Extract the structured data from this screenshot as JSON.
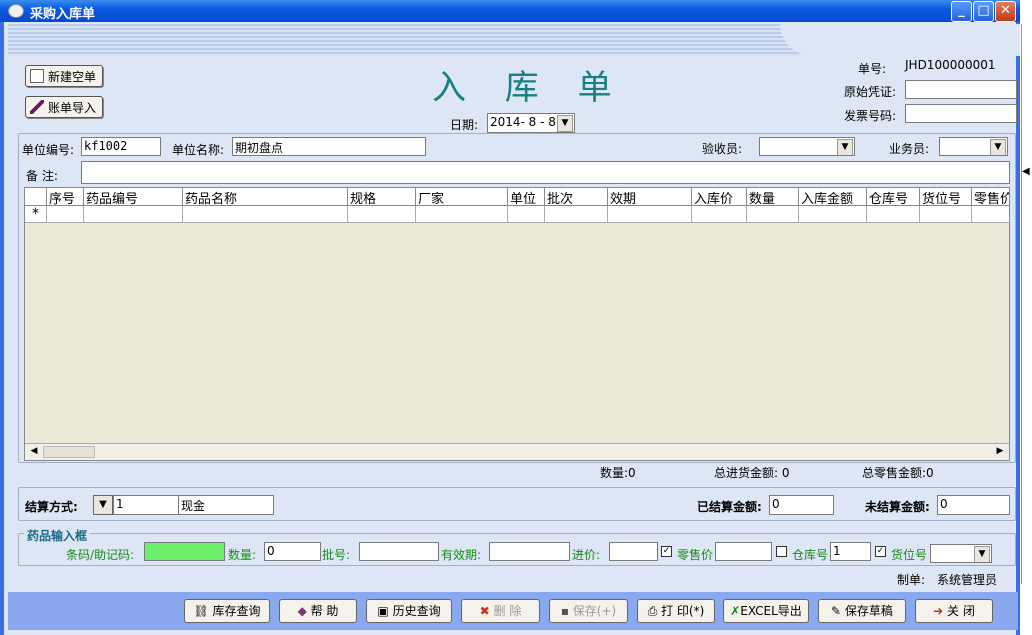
{
  "window": {
    "title": "采购入库单",
    "min": "_",
    "max": "□",
    "close": "✕"
  },
  "header": {
    "new_button": "新建空单",
    "import_button": "账单导入",
    "title": "入 库 单",
    "date_label": "日期:",
    "date_value": "2014- 8 - 8",
    "order_no_label": "单号:",
    "order_no_value": "JHD100000001",
    "voucher_label": "原始凭证:",
    "invoice_label": "发票号码:"
  },
  "form": {
    "unit_code_label": "单位编号:",
    "unit_code_value": "kf1002",
    "unit_name_label": "单位名称:",
    "unit_name_value": "期初盘点",
    "inspector_label": "验收员:",
    "salesman_label": "业务员:",
    "remark_label": "备    注:"
  },
  "grid": {
    "columns": [
      "序号",
      "药品编号",
      "药品名称",
      "规格",
      "厂家",
      "单位",
      "批次",
      "效期",
      "入库价",
      "数量",
      "入库金额",
      "仓库号",
      "货位号",
      "零售价"
    ],
    "new_row_marker": "*"
  },
  "summary": {
    "qty": "数量:0",
    "total_purchase": "总进货金额: 0",
    "total_retail": "总零售金额:0"
  },
  "settlement": {
    "method_label": "结算方式:",
    "method_code": "1",
    "method_name": "现金",
    "settled_label": "已结算金额:",
    "settled_value": "0",
    "unsettled_label": "未结算金额:",
    "unsettled_value": "0"
  },
  "input_box": {
    "group_title": "药品输入框",
    "barcode_label": "条码/助记码:",
    "qty_label": "数量:",
    "qty_value": "0",
    "batch_label": "批号:",
    "expiry_label": "有效期:",
    "price_label": "进价:",
    "retail_label": "零售价",
    "warehouse_label": "仓库号",
    "warehouse_value": "1",
    "location_label": "货位号"
  },
  "footer": {
    "maker_label": "制单:",
    "maker_value": "系统管理员"
  },
  "toolbar": {
    "stock_query": "库存查询",
    "help": "帮 助",
    "history": "历史查询",
    "delete": "删 除",
    "save": "保存(+)",
    "print": "打 印(*)",
    "excel": "EXCEL导出",
    "save_draft": "保存草稿",
    "close": "关 闭"
  }
}
